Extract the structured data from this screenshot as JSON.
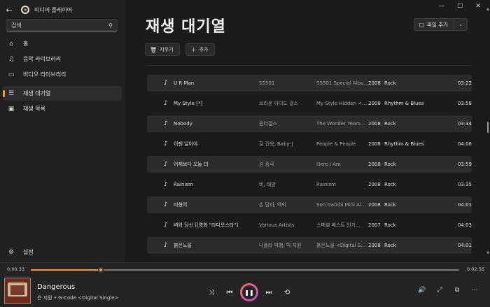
{
  "app": {
    "title": "미디어 플레이어"
  },
  "window_controls": {
    "minimize": "—",
    "maximize": "☐",
    "close": "✕"
  },
  "search": {
    "value": "검색",
    "placeholder": "검색"
  },
  "sidebar": {
    "top_items": [
      {
        "label": "홈",
        "icon": "home-icon"
      },
      {
        "label": "음악 라이브러리",
        "icon": "music-library-icon"
      },
      {
        "label": "비디오 라이브러리",
        "icon": "video-library-icon"
      }
    ],
    "mid_items": [
      {
        "label": "재생 대기열",
        "icon": "queue-icon",
        "active": true
      },
      {
        "label": "재생 목록",
        "icon": "playlist-icon"
      }
    ],
    "settings_label": "설정"
  },
  "page": {
    "title": "재생 대기열",
    "add_files_label": "파일 추가",
    "clear_label": "지우기",
    "add_label": "추가"
  },
  "tracks": [
    {
      "title": "U R Man",
      "artist": "SS501",
      "album": "SS501 Special Albu…",
      "year": "2008",
      "genre": "Rock",
      "duration": "03:22"
    },
    {
      "title": "My Style [*]",
      "artist": "브라운 아이드 걸스",
      "album": "My Style Hidden <…",
      "year": "2008",
      "genre": "Rhythm & Blues",
      "duration": "03:58"
    },
    {
      "title": "Nobody",
      "artist": "원더걸스",
      "album": "The Wonder Years…",
      "year": "2008",
      "genre": "Rock",
      "duration": "03:34"
    },
    {
      "title": "이젠 날이야",
      "artist": "김 건욱, Baby-J",
      "album": "People & People",
      "year": "2008",
      "genre": "Rhythm & Blues",
      "duration": "04:06"
    },
    {
      "title": "어제보다 오늘 더",
      "artist": "김 종국",
      "album": "Here I Am",
      "year": "2008",
      "genre": "Rock",
      "duration": "03:59"
    },
    {
      "title": "Rainism",
      "artist": "비, 태양",
      "album": "Rainism",
      "year": "2008",
      "genre": "Rock",
      "duration": "03:35"
    },
    {
      "title": "미쳤어",
      "artist": "손 담비, 엑익",
      "album": "Son Dambi Mini Al…",
      "year": "2008",
      "genre": "Rock",
      "duration": "04:01"
    },
    {
      "title": "벼와 당신 [[영화 \"라디오스타\"]",
      "artist": "Various Artists",
      "album": "스페셜 베스트 인기…",
      "year": "2007",
      "genre": "Rock",
      "duration": "04:03"
    },
    {
      "title": "붉은노을",
      "artist": "나플라 빅뱅, 빅 지원",
      "album": "붉은노을 <Digital S…",
      "year": "2008",
      "genre": "Rock",
      "duration": "04:01"
    }
  ],
  "player": {
    "current_time": "0:00:33",
    "total_time": "0:02:56",
    "progress": 0.164,
    "now_title": "Dangerous",
    "now_subtitle": "은 지원 • G-Code <Digital Single>"
  },
  "colors": {
    "accent": "#ff9a3c",
    "background": "#1b1b1b",
    "sidebar": "#202020"
  }
}
